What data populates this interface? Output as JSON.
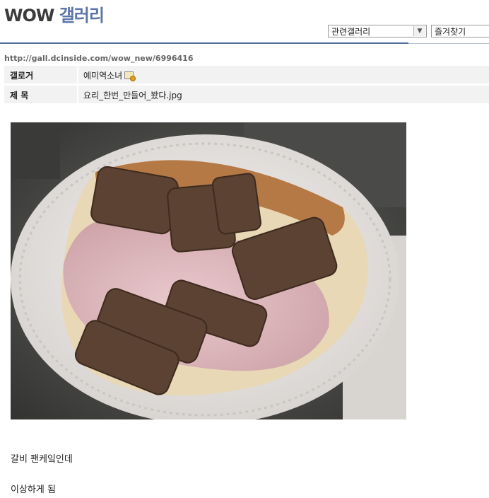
{
  "header": {
    "logo_wow": "WOW",
    "logo_gallery": "갤러리",
    "related_select": "관련갤러리",
    "favorites_select": "즐겨찾기"
  },
  "post": {
    "url": "http://gall.dcinside.com/wow_new/6996416",
    "writer_label": "갤로거",
    "writer_value": "예미역소녀",
    "title_label": "제 목",
    "title_value": "요리_한번_만들어_봤다.jpg",
    "body_lines": [
      "갈비 팬케잌인데",
      "이상하게 됨"
    ]
  },
  "colors": {
    "accent": "#56709e",
    "logo_blue": "#5b75a8",
    "row_bg": "#f2f2f2"
  },
  "icons": [
    "chevron-down-icon",
    "gallog-icon"
  ]
}
